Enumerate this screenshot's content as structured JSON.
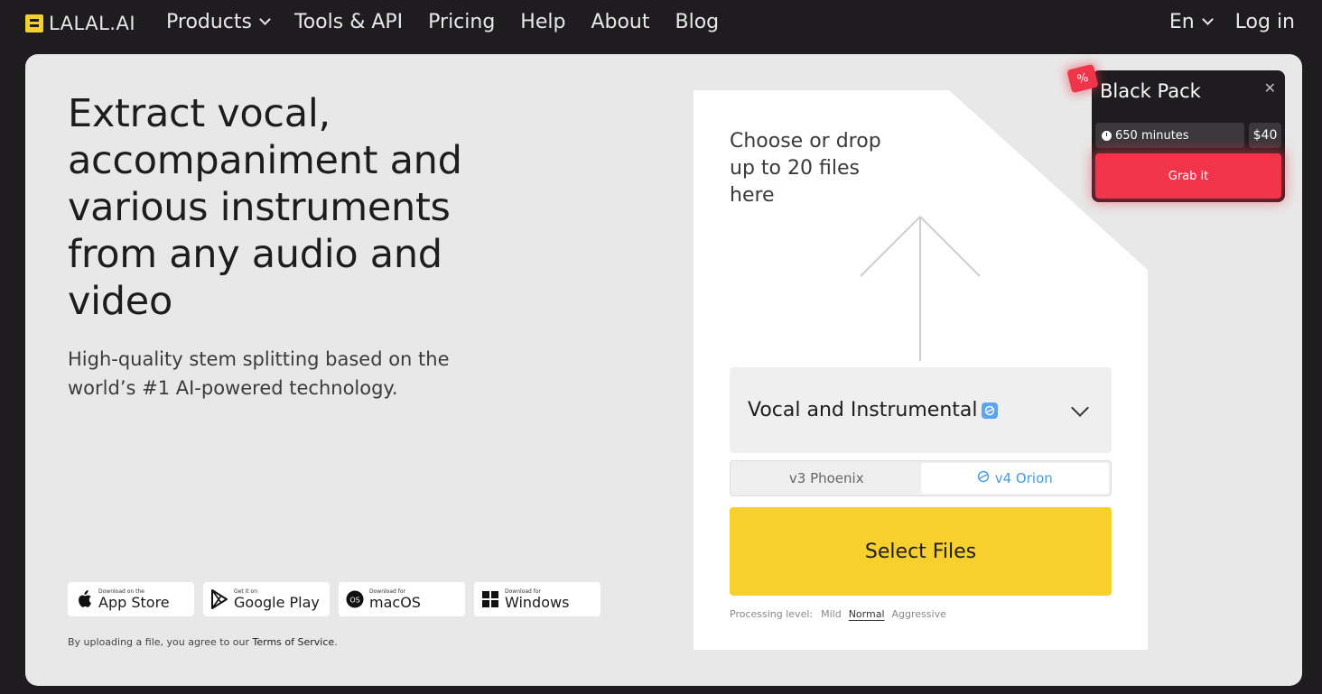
{
  "nav": {
    "logo_text": "LALAL.AI",
    "links": [
      {
        "label": "Products",
        "dropdown": true
      },
      {
        "label": "Tools & API"
      },
      {
        "label": "Pricing"
      },
      {
        "label": "Help"
      },
      {
        "label": "About"
      },
      {
        "label": "Blog"
      }
    ],
    "language": "En",
    "login": "Log in"
  },
  "hero": {
    "headline": "Extract vocal, accompaniment and various instruments from any audio and video",
    "subline": "High-quality stem splitting based on the world’s #1 AI-powered technology."
  },
  "stores": [
    {
      "small": "Download on the",
      "big": "App Store",
      "icon": "apple-icon"
    },
    {
      "small": "Get it on",
      "big": "Google Play",
      "icon": "google-play-icon"
    },
    {
      "small": "Download for",
      "big": "macOS",
      "icon": "macos-icon"
    },
    {
      "small": "Download for",
      "big": "Windows",
      "icon": "windows-icon"
    }
  ],
  "tos": {
    "prefix": "By uploading a file, you agree to our",
    "link": "Terms of Service",
    "suffix": "."
  },
  "upload": {
    "drop_text": "Choose or drop up to 20 files here",
    "stem_selected": "Vocal and Instrumental",
    "versions": [
      {
        "label": "v3 Phoenix",
        "active": false
      },
      {
        "label": "v4 Orion",
        "active": true
      }
    ],
    "select_button": "Select Files",
    "processing_label": "Processing level:",
    "processing_options": [
      "Mild",
      "Normal",
      "Aggressive"
    ],
    "processing_selected": "Normal"
  },
  "promo": {
    "badge": "%",
    "title": "Black Pack",
    "minutes": "650 minutes",
    "price": "$40",
    "cta": "Grab it"
  },
  "colors": {
    "background": "#1e1c1f",
    "card": "#e8e8e8",
    "accent_yellow": "#f7d02e",
    "promo_red": "#f0344a",
    "version_blue": "#4b9be0"
  }
}
